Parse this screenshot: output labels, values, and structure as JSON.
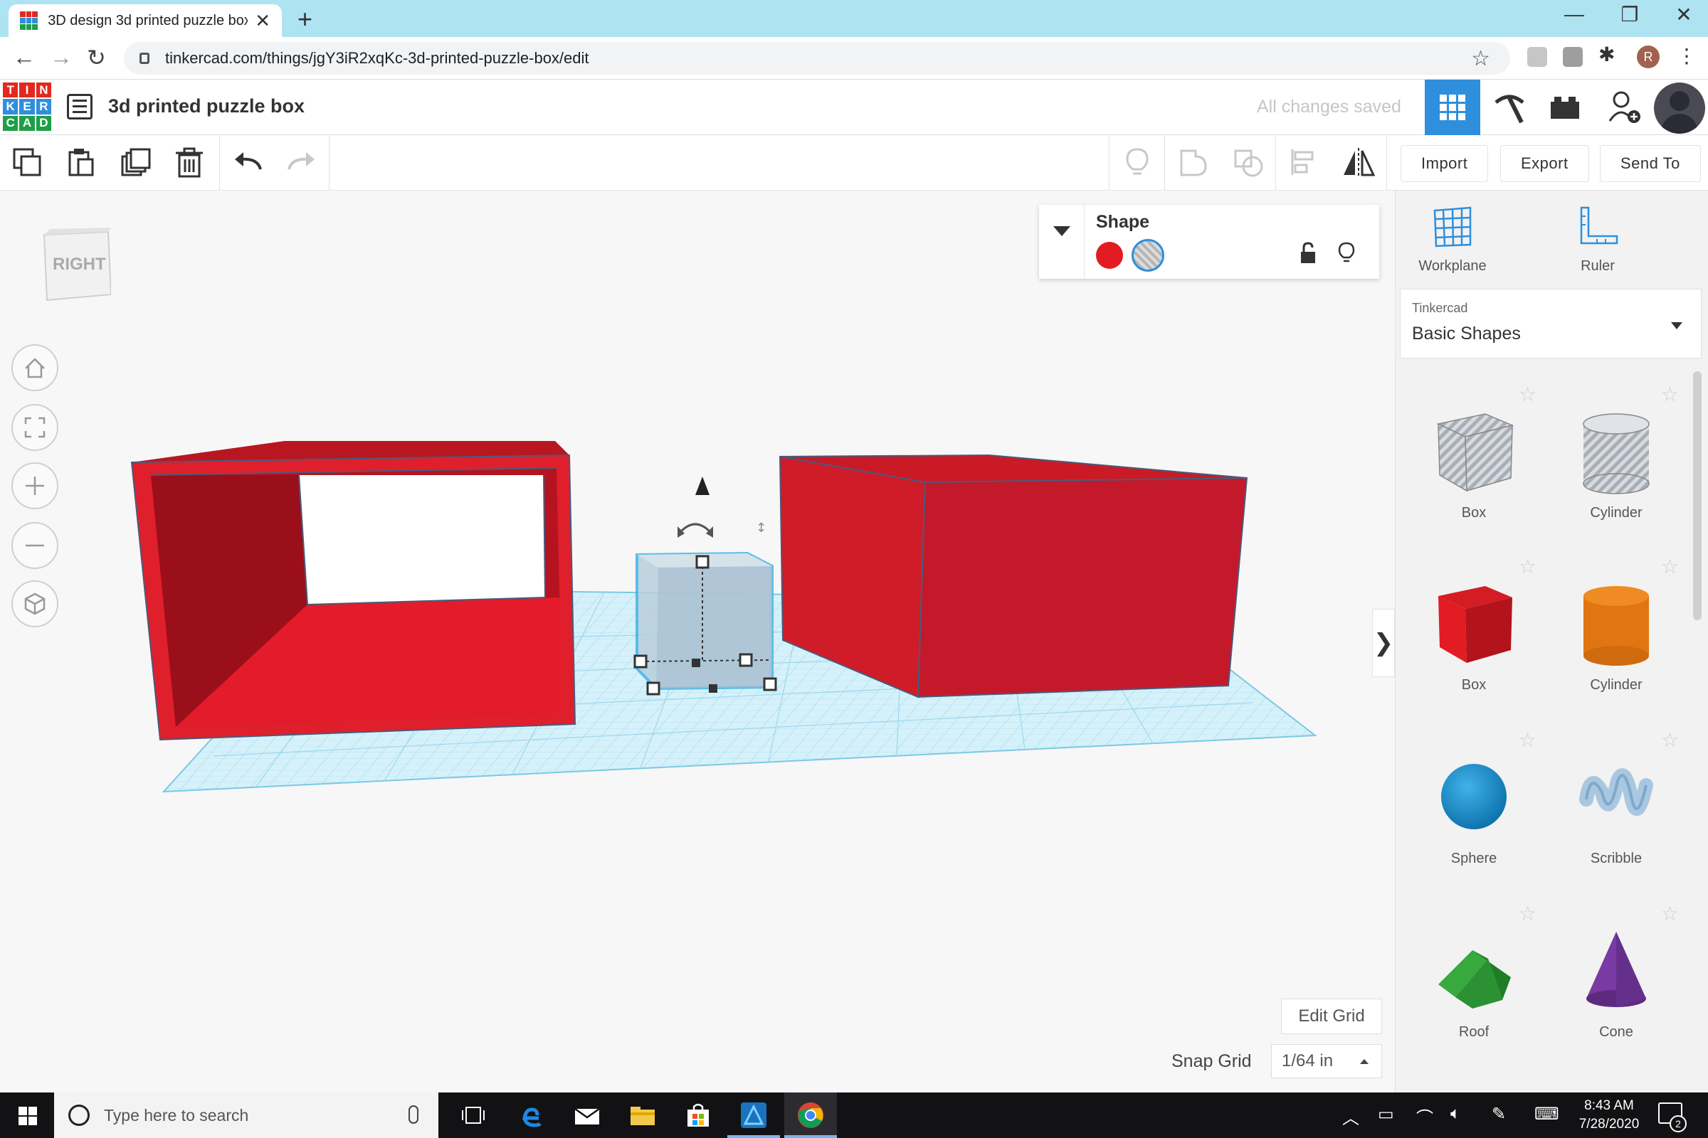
{
  "browser": {
    "tab_title": "3D design 3d printed puzzle box",
    "tab_close": "✕",
    "new_tab": "+",
    "url": "tinkercad.com/things/jgY3iR2xqKc-3d-printed-puzzle-box/edit",
    "profile_initial": "R",
    "window_controls": [
      "—",
      "❐",
      "✕"
    ]
  },
  "app": {
    "logo_letters": [
      "T",
      "I",
      "N",
      "K",
      "E",
      "R",
      "C",
      "A",
      "D"
    ],
    "logo_colors": [
      "#e2281f",
      "#e2281f",
      "#e2281f",
      "#2f8fdc",
      "#2f8fdc",
      "#2f8fdc",
      "#1e9e48",
      "#1e9e48",
      "#1e9e48"
    ],
    "design_title": "3d printed puzzle box",
    "save_status": "All changes saved",
    "accent": "#2f8fdc"
  },
  "toolbar": {
    "import_label": "Import",
    "export_label": "Export",
    "sendto_label": "Send To"
  },
  "viewport": {
    "viewcube_face": "RIGHT",
    "inspector_title": "Shape",
    "solid_color": "#e31b23",
    "edit_grid_label": "Edit Grid",
    "snap_grid_label": "Snap Grid",
    "snap_grid_value": "1/64 in"
  },
  "panel": {
    "workplane_label": "Workplane",
    "ruler_label": "Ruler",
    "library_category": "Tinkercad",
    "library_name": "Basic Shapes",
    "shapes": [
      {
        "name": "Box",
        "icon": "box-hole-icon"
      },
      {
        "name": "Cylinder",
        "icon": "cylinder-hole-icon"
      },
      {
        "name": "Box",
        "icon": "box-icon"
      },
      {
        "name": "Cylinder",
        "icon": "cylinder-icon"
      },
      {
        "name": "Sphere",
        "icon": "sphere-icon"
      },
      {
        "name": "Scribble",
        "icon": "scribble-icon"
      },
      {
        "name": "Roof",
        "icon": "roof-icon"
      },
      {
        "name": "Cone",
        "icon": "cone-icon"
      }
    ]
  },
  "taskbar": {
    "search_placeholder": "Type here to search",
    "time": "8:43 AM",
    "date": "7/28/2020",
    "notification_count": "2"
  }
}
